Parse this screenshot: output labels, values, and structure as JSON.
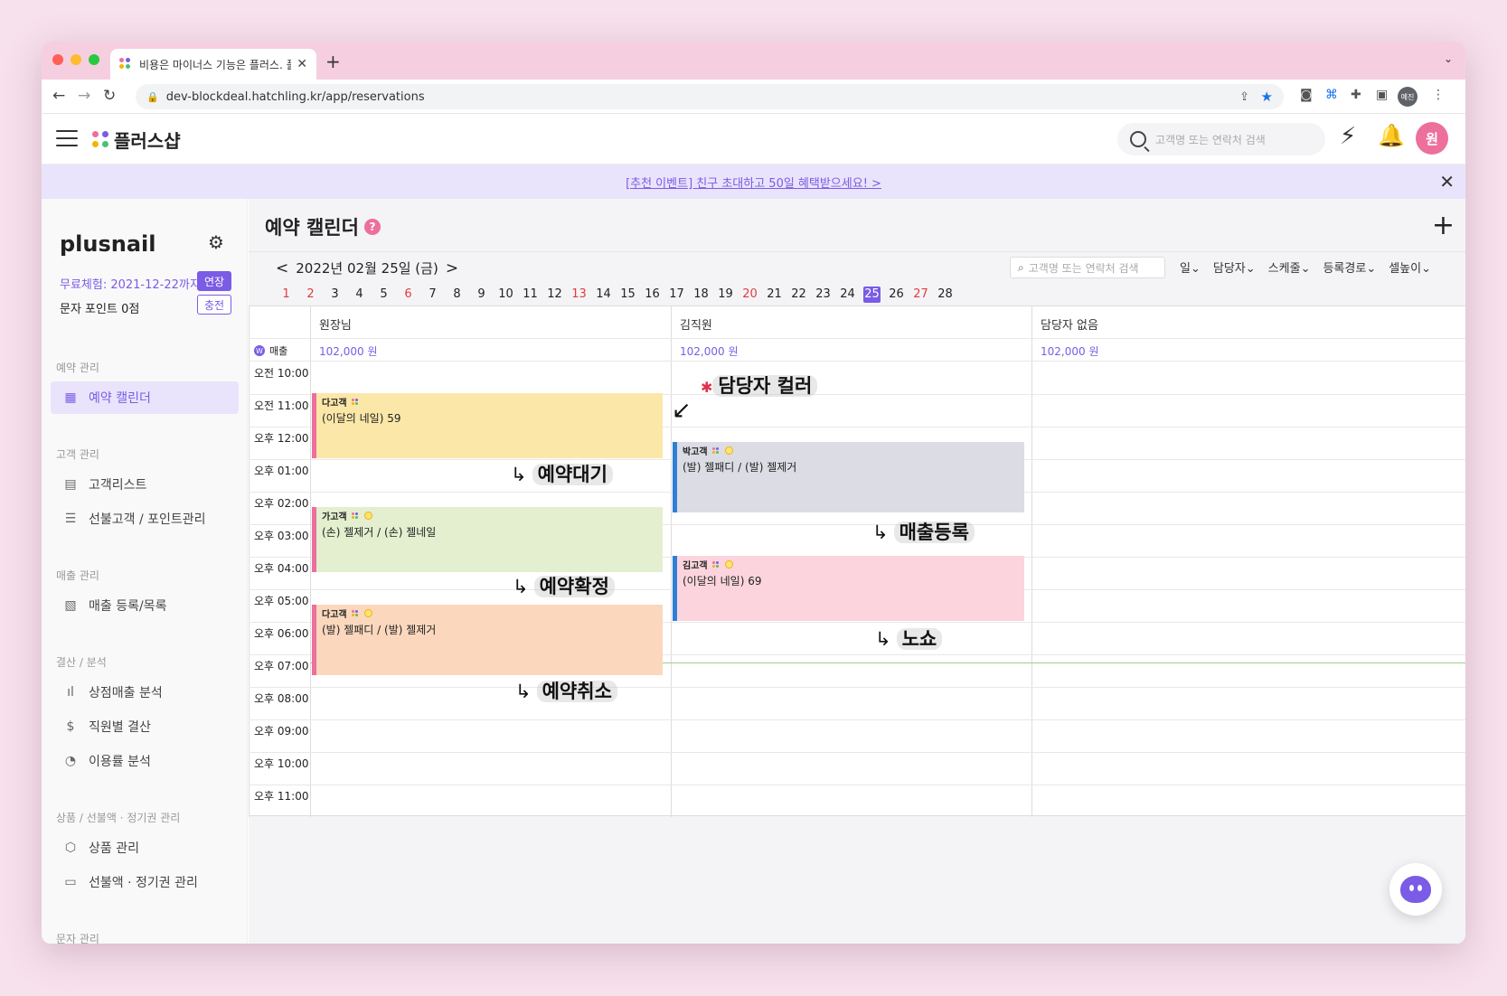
{
  "browser": {
    "tab_title": "비용은 마이너스 기능은 플러스. 플러",
    "url": "dev-blockdeal.hatchling.kr/app/reservations",
    "profile": "예진"
  },
  "header": {
    "logo": "플러스샵",
    "search_placeholder": "고객명 또는 연락처 검색",
    "avatar": "원"
  },
  "banner": {
    "text": "[추천 이벤트] 친구 초대하고 50일 혜택받으세요! >"
  },
  "sidebar": {
    "shop_name": "plusnail",
    "trial": "무료체험: 2021-12-22까지",
    "extend_label": "연장",
    "sms_points": "문자 포인트 0점",
    "charge_label": "충전",
    "sections": [
      {
        "title": "예약 관리",
        "items": [
          {
            "label": "예약 캘린더"
          }
        ]
      },
      {
        "title": "고객 관리",
        "items": [
          {
            "label": "고객리스트"
          },
          {
            "label": "선불고객 / 포인트관리"
          }
        ]
      },
      {
        "title": "매출 관리",
        "items": [
          {
            "label": "매출 등록/목록"
          }
        ]
      },
      {
        "title": "결산 / 분석",
        "items": [
          {
            "label": "상점매출 분석"
          },
          {
            "label": "직원별 결산"
          },
          {
            "label": "이용률 분석"
          }
        ]
      },
      {
        "title": "상품 / 선불액 · 정기권 관리",
        "items": [
          {
            "label": "상품 관리"
          },
          {
            "label": "선불액 · 정기권 관리"
          }
        ]
      },
      {
        "title": "문자 관리"
      }
    ]
  },
  "main": {
    "title": "예약 캘린더",
    "help": "?",
    "add": "+",
    "date": "2022년 02월 25일 (금)",
    "search_placeholder": "고객명 또는 연락처 검색",
    "filters": [
      "일",
      "담당자",
      "스케줄",
      "등록경로",
      "셀높이"
    ],
    "days": [
      "1",
      "2",
      "3",
      "4",
      "5",
      "6",
      "7",
      "8",
      "9",
      "10",
      "11",
      "12",
      "13",
      "14",
      "15",
      "16",
      "17",
      "18",
      "19",
      "20",
      "21",
      "22",
      "23",
      "24",
      "25",
      "26",
      "27",
      "28"
    ],
    "red_days": [
      "1",
      "2",
      "6",
      "13",
      "20",
      "27"
    ],
    "selected_day": "25"
  },
  "calendar": {
    "columns": [
      {
        "name": "원장님",
        "sales": "102,000 원"
      },
      {
        "name": "김직원",
        "sales": "102,000 원"
      },
      {
        "name": "담당자 없음",
        "sales": "102,000 원"
      }
    ],
    "sales_label": "매출",
    "won_icon": "W",
    "times": [
      "오전 10:00",
      "오전 11:00",
      "오후 12:00",
      "오후 01:00",
      "오후 02:00",
      "오후 03:00",
      "오후 04:00",
      "오후 05:00",
      "오후 06:00",
      "오후 07:00",
      "오후 08:00",
      "오후 09:00",
      "오후 10:00",
      "오후 11:00"
    ],
    "events": [
      {
        "customer": "다고객",
        "service": "(이달의 네일) 59",
        "status": "예약대기",
        "color": "#fbe7a8"
      },
      {
        "customer": "가고객",
        "service": "(손) 젤제거 / (손) 젤네일",
        "status": "예약확정",
        "color": "#e3efcf"
      },
      {
        "customer": "다고객",
        "service": "(발) 젤패디 / (발) 젤제거",
        "status": "예약취소",
        "color": "#fbd8bd"
      },
      {
        "customer": "박고객",
        "service": "(발) 젤패디 / (발) 젤제거",
        "status": "매출등록",
        "color": "#dcdce4"
      },
      {
        "customer": "김고객",
        "service": "(이달의 네일) 69",
        "status": "노쇼",
        "color": "#fbd4de"
      }
    ]
  },
  "annotations": {
    "staff_color": "담당자 컬러",
    "waiting": "예약대기",
    "confirmed": "예약확정",
    "cancelled": "예약취소",
    "sales_registered": "매출등록",
    "noshow": "노쇼"
  },
  "colors": {
    "accent": "#7a5ce6",
    "pink": "#ec6f9c",
    "staff_blue": "#2f7fd6"
  }
}
